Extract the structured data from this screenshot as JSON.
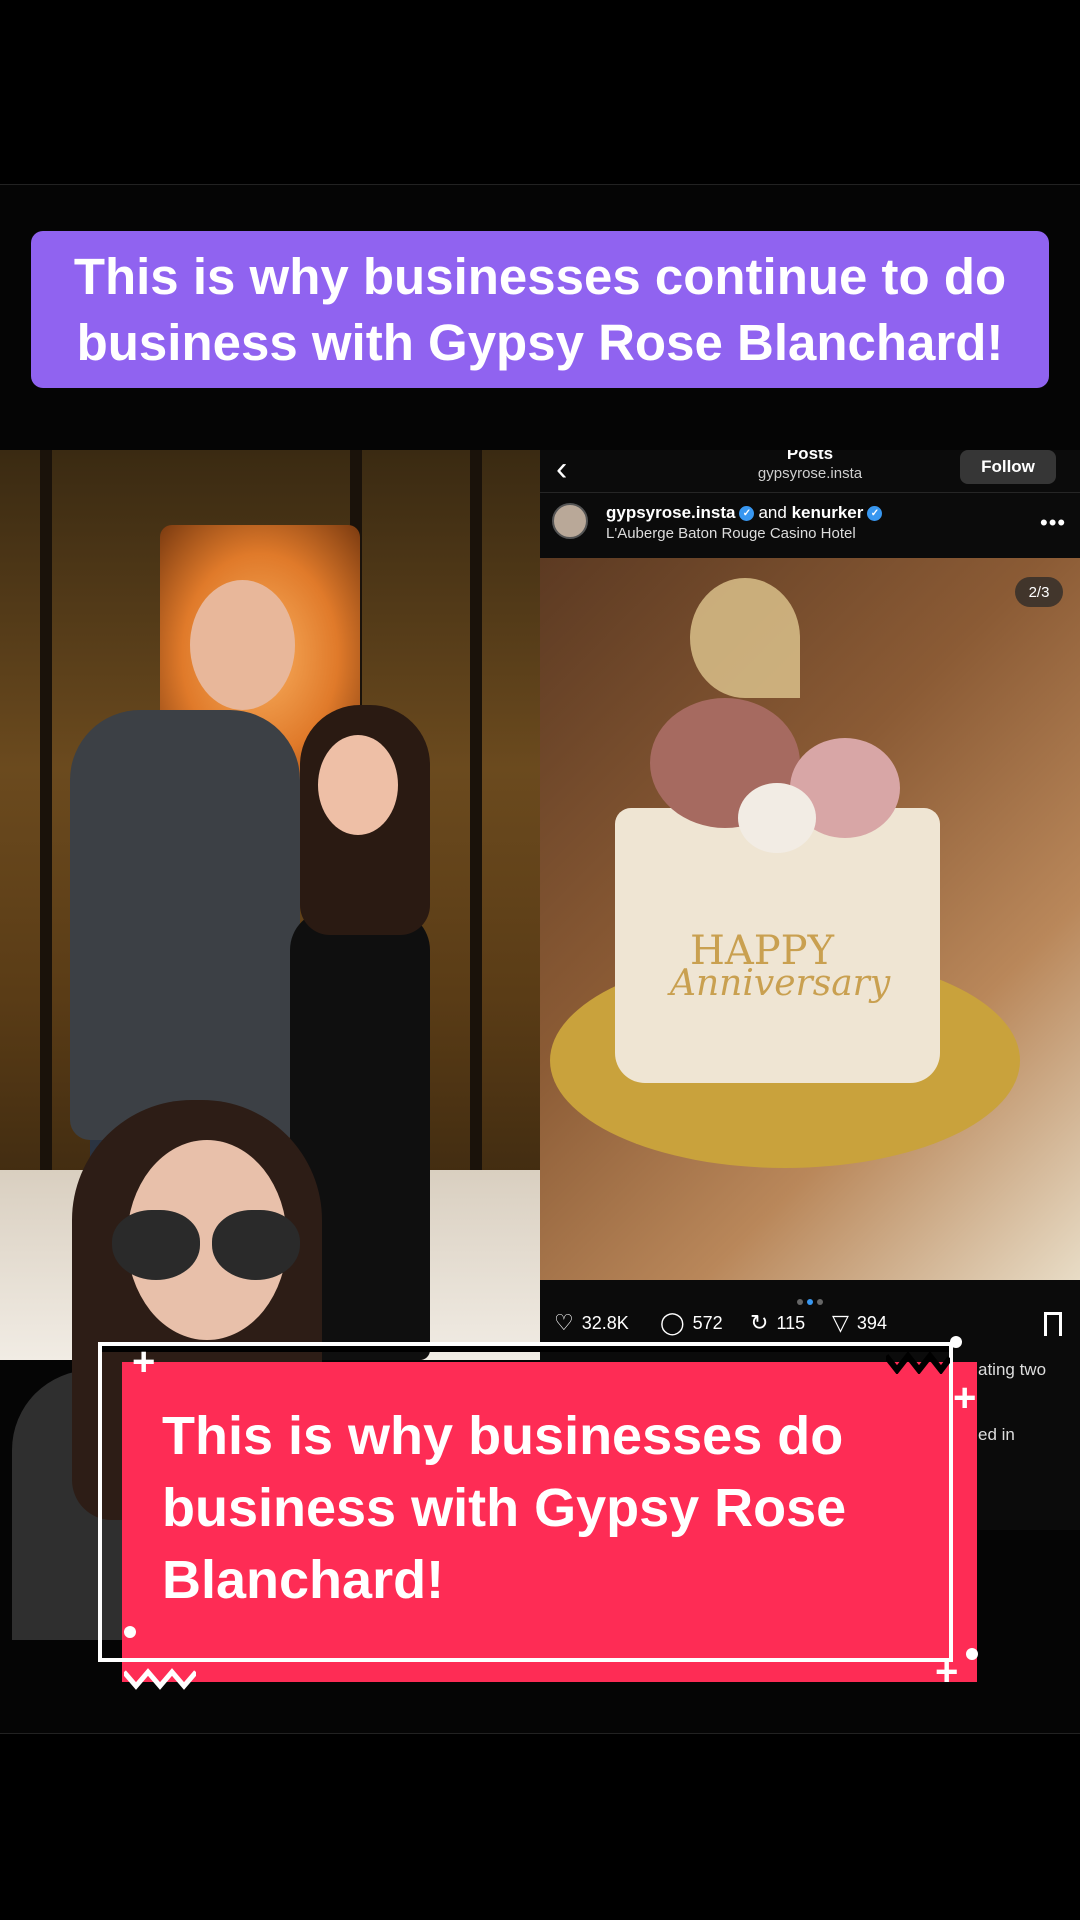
{
  "top_banner": {
    "text": "This is why businesses continue to do business with Gypsy Rose Blanchard!"
  },
  "instagram": {
    "header_title": "Posts",
    "header_handle": "gypsyrose.insta",
    "follow_label": "Follow",
    "post_user": "gypsyrose.insta",
    "post_and": "and",
    "post_collab_user": "kenurker",
    "post_location": "L'Auberge Baton Rouge Casino Hotel",
    "image_counter": "2/3",
    "cake_text_line1": "HAPPY",
    "cake_text_line2": "Anniversary",
    "likes": "32.8K",
    "comments": "572",
    "reposts": "115",
    "shares": "394",
    "caption_fragment_1": "ating two",
    "caption_fragment_2": "ed in"
  },
  "bottom_banner": {
    "text": "This is why businesses do business with Gypsy Rose Blanchard!"
  },
  "colors": {
    "top_banner": "#9063f0",
    "bottom_banner": "#fe2c55",
    "verified": "#3897f0"
  },
  "icons": [
    "back-arrow-icon",
    "verified-icon",
    "more-icon",
    "heart-icon",
    "comment-icon",
    "repost-icon",
    "share-icon",
    "bookmark-icon"
  ]
}
